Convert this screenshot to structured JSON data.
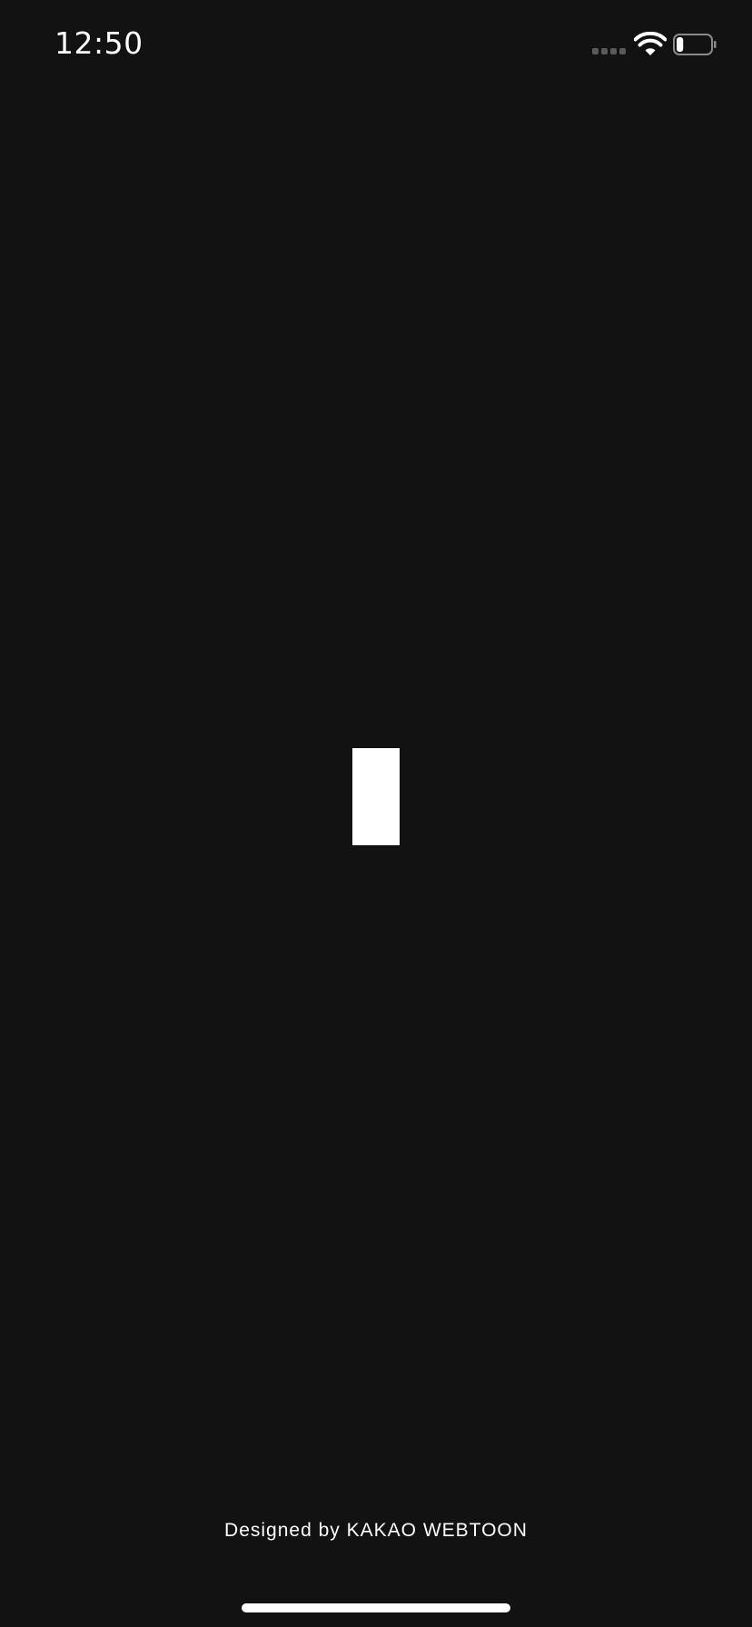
{
  "status_bar": {
    "time": "12:50",
    "signal_icon": "cellular-signal-icon",
    "wifi_icon": "wifi-icon",
    "battery_icon": "battery-icon",
    "battery_level": 0.2
  },
  "splash": {
    "logo_icon": "webtoon-logo-icon"
  },
  "footer": {
    "credit": "Designed by KAKAO WEBTOON"
  },
  "colors": {
    "background": "#121212",
    "foreground": "#ffffff",
    "signal_inactive": "#5a5a5a"
  }
}
